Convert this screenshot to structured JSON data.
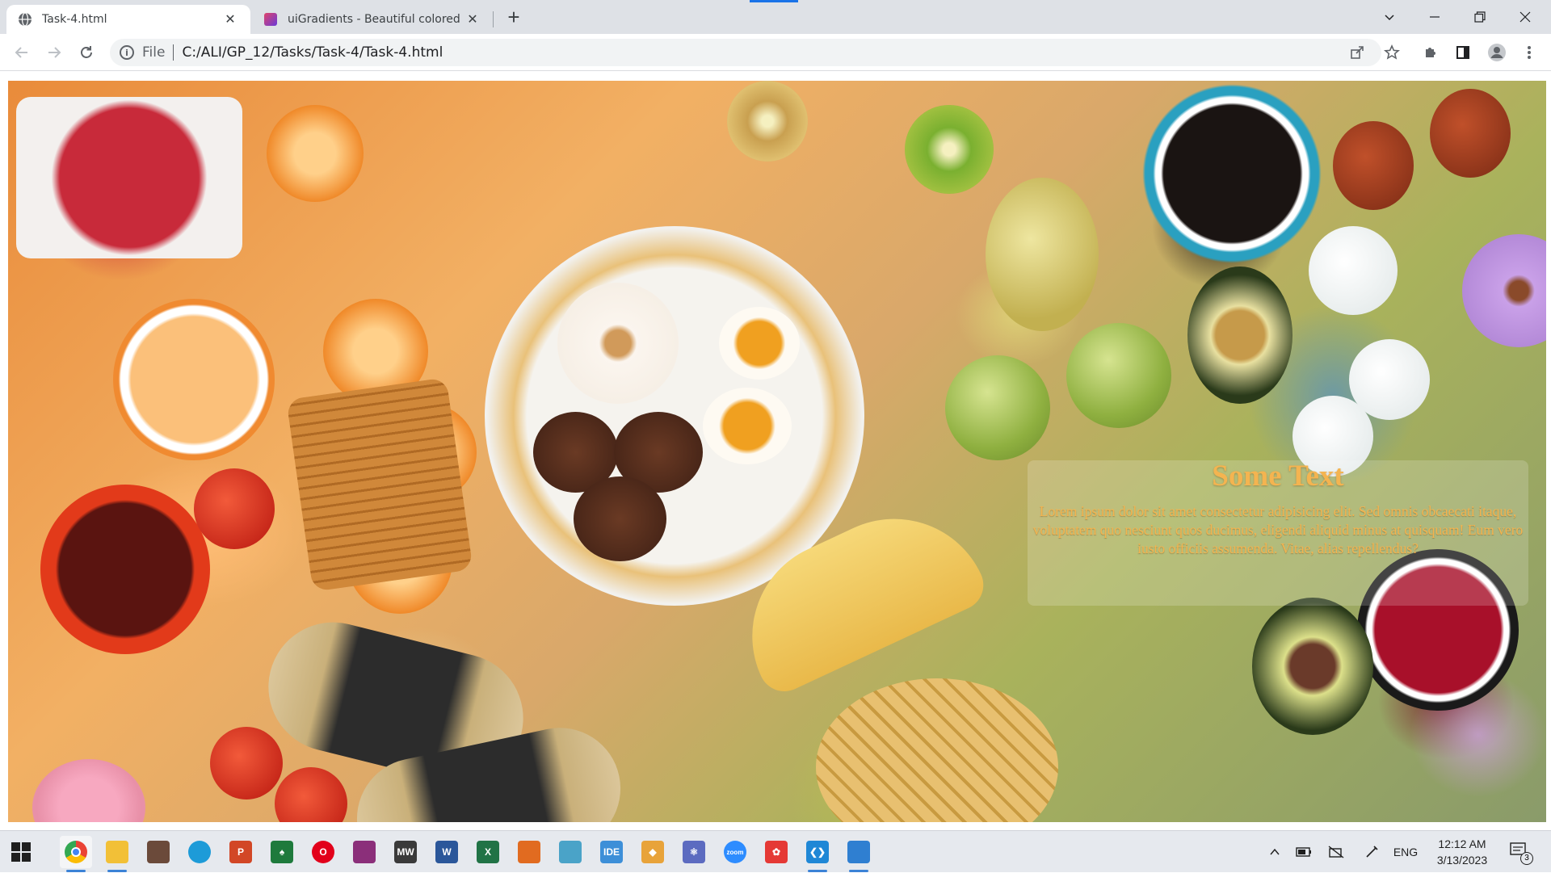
{
  "browser": {
    "tabs": [
      {
        "title": "Task-4.html",
        "favicon": "globe-icon",
        "active": true
      },
      {
        "title": "uiGradients - Beautiful colored gr",
        "favicon": "uigradients-icon",
        "active": false
      }
    ],
    "close_glyph": "✕",
    "new_tab_glyph": "+",
    "address": {
      "scheme_label": "File",
      "url": "C:/ALI/GP_12/Tasks/Task-4/Task-4.html"
    },
    "accent_color": "#1a73e8"
  },
  "page": {
    "caption": {
      "title": "Some Text",
      "body": "Lorem ipsum dolor sit amet consectetur adipisicing elit. Sed omnis obcaecati itaque, voluptatem quo nesciunt quos ducimus, eligendi aliquid minus at quisquam! Eum vero iusto officiis assumenda. Vitae, alias repellendus?",
      "text_color": "#f4b450"
    },
    "background_image": "breakfast-food-spread-photo"
  },
  "taskbar": {
    "apps": [
      {
        "name": "chrome-icon",
        "label": "",
        "color": "#ffffff",
        "open": true,
        "active": true
      },
      {
        "name": "file-explorer-icon",
        "label": "",
        "color": "#f2c037",
        "open": true,
        "active": false
      },
      {
        "name": "photo-viewer-icon",
        "label": "",
        "color": "#6b4a3a",
        "open": false,
        "active": false
      },
      {
        "name": "edge-icon",
        "label": "",
        "color": "#1d9bd8",
        "open": false,
        "active": false
      },
      {
        "name": "powerpoint-icon",
        "label": "P",
        "color": "#d24726",
        "open": false,
        "active": false
      },
      {
        "name": "solitaire-icon",
        "label": "♠",
        "color": "#1e7a3c",
        "open": false,
        "active": false
      },
      {
        "name": "opera-icon",
        "label": "O",
        "color": "#e2001a",
        "open": false,
        "active": false
      },
      {
        "name": "winrar-icon",
        "label": "",
        "color": "#8b2f7a",
        "open": false,
        "active": false
      },
      {
        "name": "mathworks-icon",
        "label": "MW",
        "color": "#3a3a3a",
        "open": false,
        "active": false
      },
      {
        "name": "word-icon",
        "label": "W",
        "color": "#2b579a",
        "open": false,
        "active": false
      },
      {
        "name": "excel-icon",
        "label": "X",
        "color": "#217346",
        "open": false,
        "active": false
      },
      {
        "name": "matlab-icon",
        "label": "",
        "color": "#e16b20",
        "open": false,
        "active": false
      },
      {
        "name": "simulink-icon",
        "label": "",
        "color": "#4aa3c8",
        "open": false,
        "active": false
      },
      {
        "name": "ide-icon",
        "label": "IDE",
        "color": "#3d8fd8",
        "open": false,
        "active": false
      },
      {
        "name": "git-icon",
        "label": "◆",
        "color": "#e8a33a",
        "open": false,
        "active": false
      },
      {
        "name": "atom-icon",
        "label": "⚛",
        "color": "#5c6bc0",
        "open": false,
        "active": false
      },
      {
        "name": "zoom-icon",
        "label": "zoom",
        "color": "#2d8cff",
        "open": false,
        "active": false
      },
      {
        "name": "app-icon",
        "label": "✿",
        "color": "#e53935",
        "open": false,
        "active": false
      },
      {
        "name": "vscode-icon",
        "label": "❮❯",
        "color": "#1f87d6",
        "open": true,
        "active": false
      },
      {
        "name": "photos-icon",
        "label": "",
        "color": "#2f7fd1",
        "open": true,
        "active": false
      }
    ],
    "tray": {
      "language": "ENG",
      "time": "12:12 AM",
      "date": "3/13/2023",
      "notification_count": "3"
    }
  }
}
